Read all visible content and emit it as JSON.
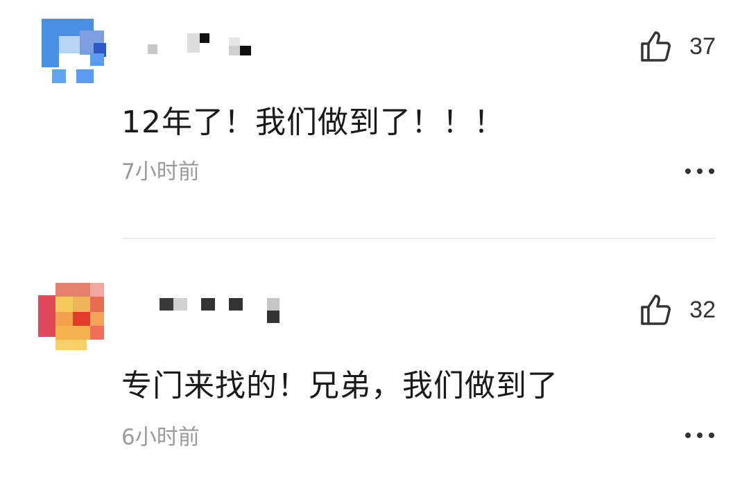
{
  "comments": [
    {
      "avatar_icon": "pixelated-avatar-blue",
      "username": "",
      "like_icon": "thumbs-up-icon",
      "likes": "37",
      "text": "12年了！我们做到了！！！",
      "time": "7小时前",
      "more_icon": "more-options-icon"
    },
    {
      "avatar_icon": "pixelated-avatar-orange",
      "username": "",
      "like_icon": "thumbs-up-icon",
      "likes": "32",
      "text": "专门来找的！兄弟，我们做到了",
      "time": "6小时前",
      "more_icon": "more-options-icon"
    }
  ],
  "colors": {
    "text": "#1a1a1a",
    "meta": "#9a9a9a",
    "divider": "#eeeeee",
    "avatar1": "#3b8cf0",
    "avatar2": "#e8734a"
  }
}
